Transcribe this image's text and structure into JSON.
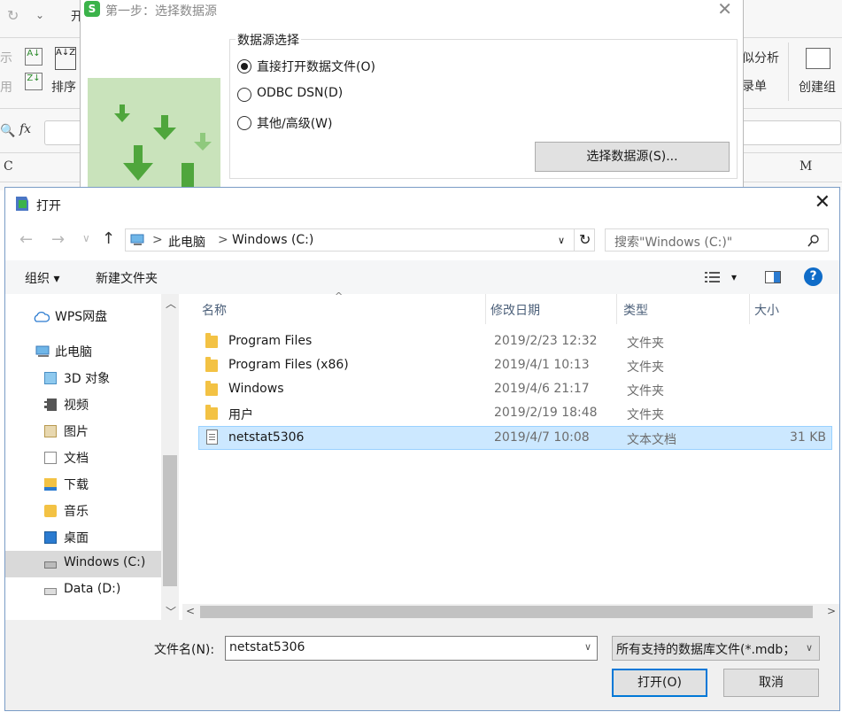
{
  "background": {
    "ribbon_partial": [
      "开",
      "示",
      "用",
      "排序",
      "似分析",
      "录单",
      "创建组"
    ],
    "fx": "fx",
    "col_c": "C",
    "col_m": "M"
  },
  "wizard": {
    "logo": "S",
    "title": "第一步：选择数据源",
    "group_label": "数据源选择",
    "options": [
      "直接打开数据文件(O)",
      "ODBC DSN(D)",
      "其他/高级(W)"
    ],
    "select_button": "选择数据源(S)...",
    "close": "✕"
  },
  "dialog": {
    "title": "打开",
    "close": "✕",
    "nav": {
      "back": "←",
      "forward": "→",
      "dropdown": "∨",
      "up": "↑"
    },
    "address": {
      "crumbs": [
        "此电脑",
        "Windows (C:)"
      ],
      "sep": ">"
    },
    "refresh": "↻",
    "search_placeholder": "搜索\"Windows (C:)\"",
    "toolbar": {
      "organize": "组织 ▾",
      "new_folder": "新建文件夹",
      "view": "▾",
      "help": "?"
    },
    "sidebar": [
      {
        "label": "WPS网盘"
      },
      {
        "label": "此电脑"
      },
      {
        "label": "3D 对象"
      },
      {
        "label": "视频"
      },
      {
        "label": "图片"
      },
      {
        "label": "文档"
      },
      {
        "label": "下载"
      },
      {
        "label": "音乐"
      },
      {
        "label": "桌面"
      },
      {
        "label": "Windows (C:)"
      },
      {
        "label": "Data (D:)"
      }
    ],
    "columns": [
      "名称",
      "修改日期",
      "类型",
      "大小"
    ],
    "files": [
      {
        "name": "Program Files",
        "date": "2019/2/23 12:32",
        "type": "文件夹",
        "size": ""
      },
      {
        "name": "Program Files (x86)",
        "date": "2019/4/1 10:13",
        "type": "文件夹",
        "size": ""
      },
      {
        "name": "Windows",
        "date": "2019/4/6 21:17",
        "type": "文件夹",
        "size": ""
      },
      {
        "name": "用户",
        "date": "2019/2/19 18:48",
        "type": "文件夹",
        "size": ""
      },
      {
        "name": "netstat5306",
        "date": "2019/4/7 10:08",
        "type": "文本文档",
        "size": "31 KB"
      }
    ],
    "filename_label": "文件名(N):",
    "filename_value": "netstat5306",
    "filetype_value": "所有支持的数据库文件(*.mdb；",
    "open_button": "打开(O)",
    "cancel_button": "取消"
  }
}
